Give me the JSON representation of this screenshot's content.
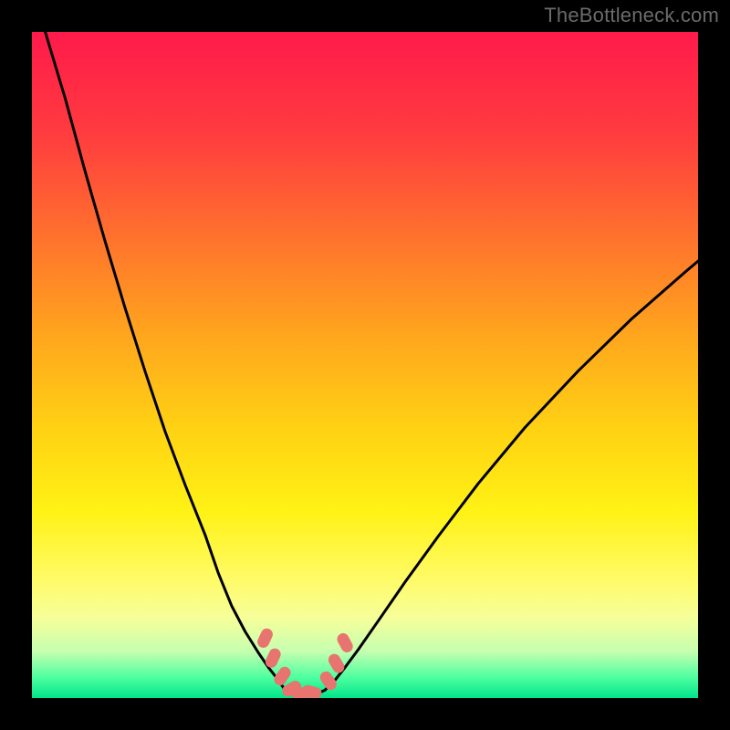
{
  "watermark": "TheBottleneck.com",
  "chart_data": {
    "type": "line",
    "title": "",
    "xlabel": "",
    "ylabel": "",
    "xlim": [
      0,
      100
    ],
    "ylim": [
      0,
      100
    ],
    "grid": false,
    "legend": false,
    "background_gradient": {
      "stops": [
        {
          "offset": 0.0,
          "color": "#ff1a4b"
        },
        {
          "offset": 0.15,
          "color": "#ff3b3f"
        },
        {
          "offset": 0.3,
          "color": "#ff6f2e"
        },
        {
          "offset": 0.45,
          "color": "#ffa41e"
        },
        {
          "offset": 0.6,
          "color": "#ffd313"
        },
        {
          "offset": 0.72,
          "color": "#fff215"
        },
        {
          "offset": 0.82,
          "color": "#fffb66"
        },
        {
          "offset": 0.88,
          "color": "#f6ff9a"
        },
        {
          "offset": 0.93,
          "color": "#c6ffb0"
        },
        {
          "offset": 0.97,
          "color": "#4bff9f"
        },
        {
          "offset": 1.0,
          "color": "#00e58a"
        }
      ]
    },
    "series": [
      {
        "name": "left-curve",
        "color": "#000000",
        "stroke_width": 3,
        "x": [
          2,
          5,
          8,
          11,
          14,
          17,
          20,
          23,
          26,
          28,
          30,
          32,
          34,
          35.5,
          37,
          38
        ],
        "y": [
          100,
          90,
          79,
          68.5,
          58.5,
          49,
          40,
          32,
          24.5,
          18.7,
          13.8,
          10,
          6.8,
          4.6,
          2.7,
          1.2
        ]
      },
      {
        "name": "right-curve",
        "color": "#000000",
        "stroke_width": 3,
        "x": [
          44,
          45.5,
          47,
          49,
          52,
          56,
          61,
          67,
          74,
          82,
          90,
          98,
          100
        ],
        "y": [
          1.2,
          2.7,
          4.6,
          7.3,
          11.6,
          17.4,
          24.3,
          32.2,
          40.6,
          49.1,
          56.9,
          63.9,
          65.6
        ]
      },
      {
        "name": "valley-floor",
        "color": "#000000",
        "stroke_width": 3,
        "x": [
          38,
          39.5,
          41,
          42.5,
          44
        ],
        "y": [
          1.2,
          0.5,
          0.3,
          0.5,
          1.2
        ]
      }
    ],
    "markers": [
      {
        "name": "valley-markers",
        "shape": "capsule",
        "color": "#e8746f",
        "points": [
          {
            "x": 35.0,
            "y": 9.0,
            "rot": -65
          },
          {
            "x": 36.2,
            "y": 6.0,
            "rot": -65
          },
          {
            "x": 37.6,
            "y": 3.3,
            "rot": -55
          },
          {
            "x": 39.0,
            "y": 1.4,
            "rot": -30
          },
          {
            "x": 40.5,
            "y": 0.7,
            "rot": -5
          },
          {
            "x": 42.0,
            "y": 0.9,
            "rot": 15
          },
          {
            "x": 44.5,
            "y": 2.6,
            "rot": 55
          },
          {
            "x": 45.7,
            "y": 5.2,
            "rot": 60
          },
          {
            "x": 47.0,
            "y": 8.3,
            "rot": 62
          }
        ]
      }
    ]
  }
}
